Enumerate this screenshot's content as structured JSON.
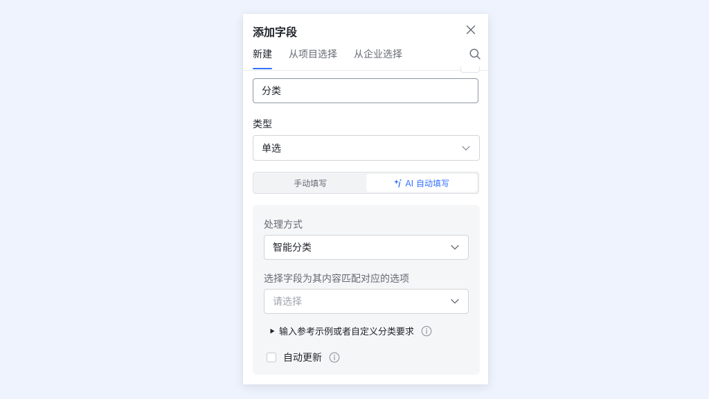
{
  "dialog": {
    "title": "添加字段",
    "tabs": [
      {
        "label": "新建",
        "active": true
      },
      {
        "label": "从项目选择",
        "active": false
      },
      {
        "label": "从企业选择",
        "active": false
      }
    ],
    "icons": {
      "close": "close-icon",
      "search": "search-icon"
    }
  },
  "form": {
    "name_value": "分类",
    "type_label": "类型",
    "type_value": "单选",
    "fill_modes": [
      {
        "label": "手动填写",
        "active": false
      },
      {
        "label": "AI 自动填写",
        "active": true,
        "icon": "sparkle-icon"
      }
    ],
    "ai": {
      "method_label": "处理方式",
      "method_value": "智能分类",
      "source_label": "选择字段为其内容匹配对应的选项",
      "source_placeholder": "请选择",
      "hint_text": "输入参考示例或者自定义分类要求",
      "auto_update_label": "自动更新",
      "auto_update_checked": false
    }
  },
  "colors": {
    "accent": "#3370ff",
    "background": "#eef3fd",
    "panel": "#ffffff",
    "ai_box": "#f5f6f7"
  }
}
